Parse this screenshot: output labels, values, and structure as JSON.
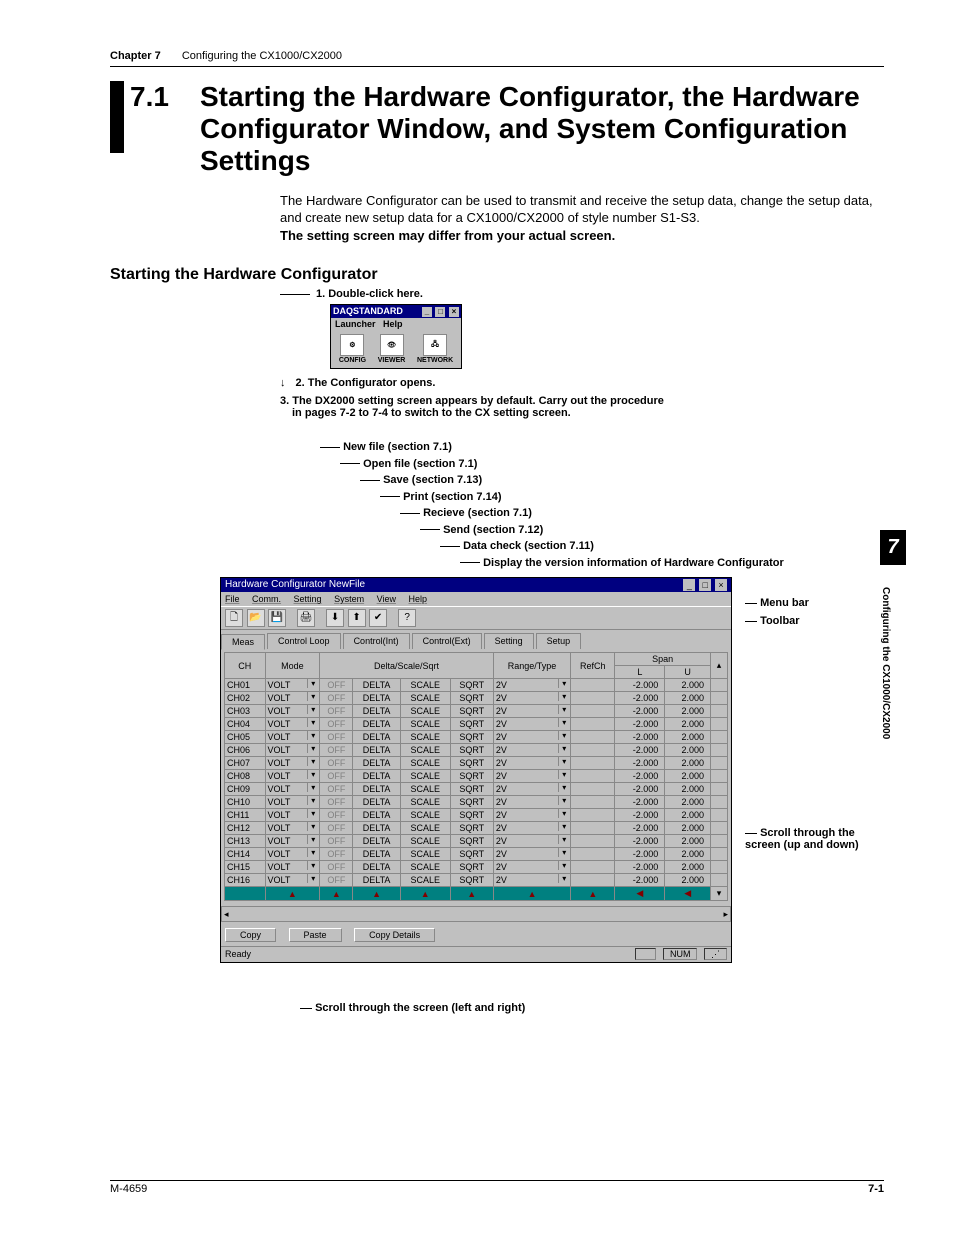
{
  "runningHead": {
    "chapter": "Chapter 7",
    "title": "Configuring the CX1000/CX2000"
  },
  "section": {
    "number": "7.1",
    "title": "Starting the Hardware Configurator, the Hardware Configurator Window, and System Configuration Settings"
  },
  "intro": {
    "p1": "The Hardware Configurator can be used to transmit and receive the setup data, change the setup data, and create new setup data for a CX1000/CX2000 of style number S1-S3.",
    "p2": "The setting screen may differ from your actual screen."
  },
  "subheading": "Starting the Hardware Configurator",
  "steps": {
    "s1": "1. Double-click here.",
    "s2": "2. The Configurator opens.",
    "s3a": "3. The DX2000 setting screen appears by default. Carry out the procedure",
    "s3b": "in pages 7-2 to 7-4 to switch to the CX setting screen."
  },
  "daq": {
    "title": "DAQSTANDARD",
    "menu": {
      "launcher": "Launcher",
      "help": "Help"
    },
    "icons": {
      "config": "CONFIG",
      "viewer": "VIEWER",
      "network": "NETWORK"
    }
  },
  "callouts": {
    "newfile": "New file (section 7.1)",
    "openfile": "Open file (section 7.1)",
    "save": "Save (section 7.13)",
    "print": "Print (section 7.14)",
    "receive": "Recieve (section 7.1)",
    "send": "Send (section 7.12)",
    "datacheck": "Data check (section 7.11)",
    "version": "Display the version information of Hardware Configurator"
  },
  "sideLabels": {
    "menubar": "Menu bar",
    "toolbar": "Toolbar",
    "scrollUD": "Scroll through the screen (up and down)",
    "scrollLR": "Scroll through the screen (left and right)"
  },
  "hw": {
    "title": "Hardware Configurator NewFile",
    "menu": {
      "file": "File",
      "comm": "Comm.",
      "setting": "Setting",
      "system": "System",
      "view": "View",
      "help": "Help"
    },
    "tabs": {
      "meas": "Meas",
      "ctrlLoop": "Control Loop",
      "ctrlInt": "Control(Int)",
      "ctrlExt": "Control(Ext)",
      "setting": "Setting",
      "setup": "Setup"
    },
    "headers": {
      "ch": "CH",
      "mode": "Mode",
      "dss": "Delta/Scale/Sqrt",
      "rt": "Range/Type",
      "refch": "RefCh",
      "span": "Span",
      "spanL": "L",
      "spanU": "U"
    },
    "cells": {
      "volt": "VOLT",
      "off": "OFF",
      "delta": "DELTA",
      "scale": "SCALE",
      "sqrt": "SQRT",
      "rt": "2V",
      "lval": "-2.000",
      "uval": "2.000"
    },
    "channels": [
      "CH01",
      "CH02",
      "CH03",
      "CH04",
      "CH05",
      "CH06",
      "CH07",
      "CH08",
      "CH09",
      "CH10",
      "CH11",
      "CH12",
      "CH13",
      "CH14",
      "CH15",
      "CH16"
    ],
    "buttons": {
      "copy": "Copy",
      "paste": "Paste",
      "copyDetails": "Copy Details"
    },
    "status": {
      "ready": "Ready",
      "num": "NUM"
    }
  },
  "indexTab": {
    "num": "7",
    "text": "Configuring the CX1000/CX2000"
  },
  "footer": {
    "left": "M-4659",
    "right": "7-1"
  }
}
